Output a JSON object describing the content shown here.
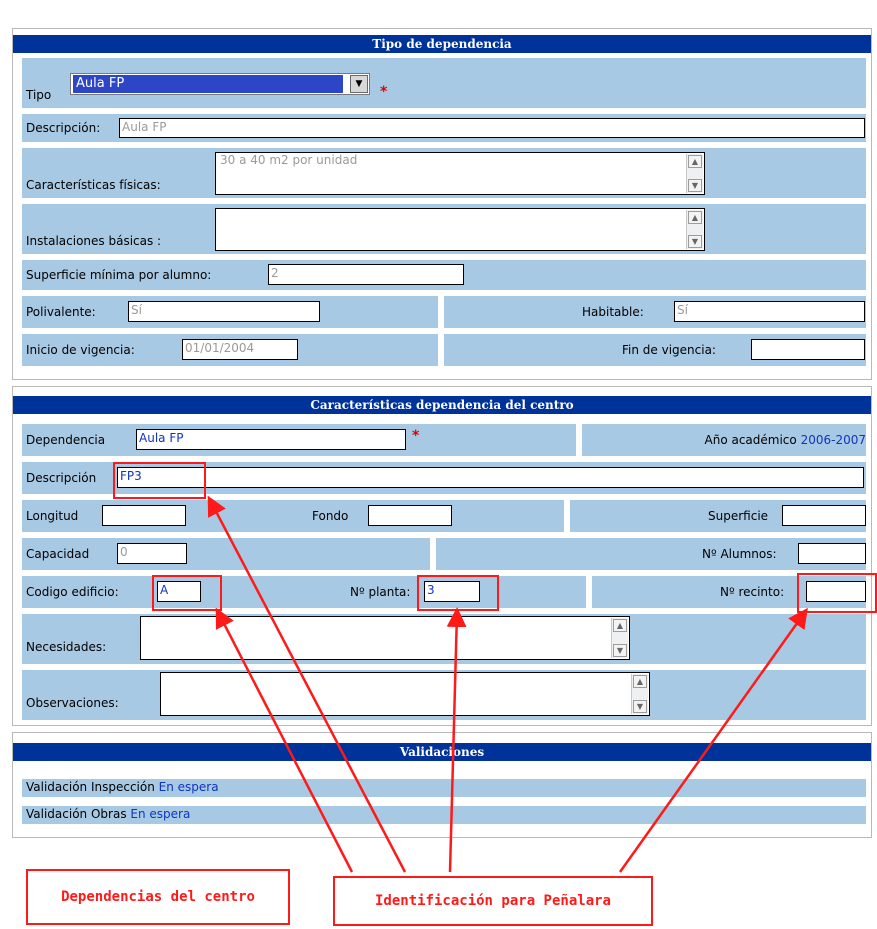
{
  "section1": {
    "title": "Tipo de dependencia",
    "tipo_label": "Tipo",
    "tipo_value": "Aula FP",
    "descripcion_label": "Descripción:",
    "descripcion_value": "Aula FP",
    "caracteristicas_label": "Características físicas:",
    "caracteristicas_value": "30 a 40 m2 por unidad",
    "instalaciones_label": "Instalaciones básicas :",
    "instalaciones_value": "",
    "superficie_label": "Superficie mínima por alumno:",
    "superficie_value": "2",
    "polivalente_label": "Polivalente:",
    "polivalente_value": "Sí",
    "habitable_label": "Habitable:",
    "habitable_value": "Sí",
    "inicio_label": "Inicio de vigencia:",
    "inicio_value": "01/01/2004",
    "fin_label": "Fin de vigencia:",
    "fin_value": ""
  },
  "section2": {
    "title": "Características dependencia del centro",
    "dependencia_label": "Dependencia",
    "dependencia_value": "Aula FP",
    "anio_label": "Año académico",
    "anio_value": "2006-2007",
    "descripcion_label": "Descripción",
    "descripcion_value": "FP3",
    "longitud_label": "Longitud",
    "fondo_label": "Fondo",
    "superficie_label": "Superficie",
    "capacidad_label": "Capacidad",
    "capacidad_value": "0",
    "nalumnos_label": "Nº Alumnos:",
    "codigo_label": "Codigo edificio:",
    "codigo_value": "A",
    "planta_label": "Nº planta:",
    "planta_value": "3",
    "recinto_label": "Nº recinto:",
    "recinto_value": "",
    "necesidades_label": "Necesidades:",
    "observaciones_label": "Observaciones:"
  },
  "section3": {
    "title": "Validaciones",
    "inspeccion_label": "Validación Inspección",
    "inspeccion_value": "En espera",
    "obras_label": "Validación Obras",
    "obras_value": "En espera"
  },
  "callouts": {
    "left": "Dependencias del centro",
    "right": "Identificación para Peñalara"
  },
  "colors": {
    "header": "#003399",
    "row": "#a8c9e3",
    "annotation": "#ff1a1a",
    "link": "#1233c0"
  }
}
